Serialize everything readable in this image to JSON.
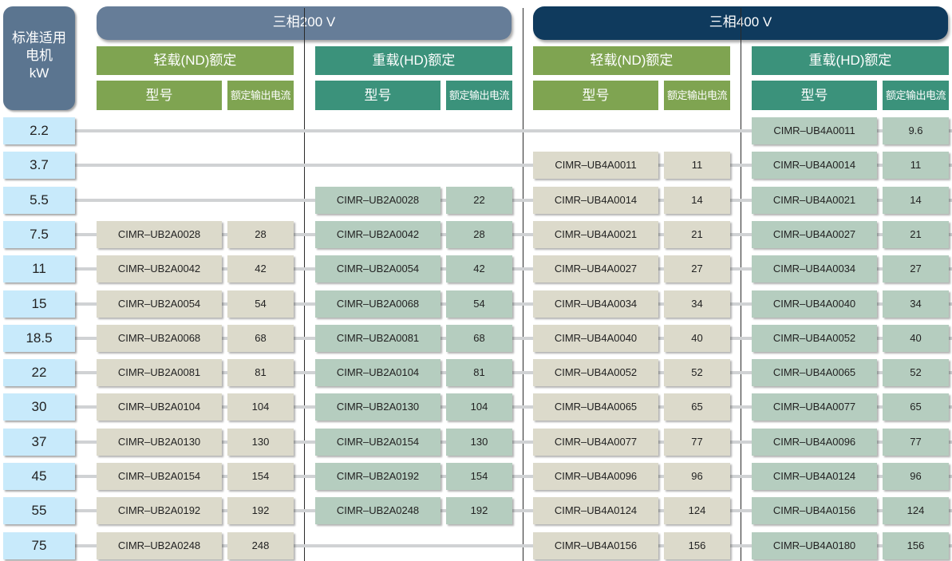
{
  "header": {
    "kw_label_lines": [
      "标准适用",
      "电机",
      "kW"
    ],
    "phase_200": "三相200 V",
    "phase_400": "三相400 V",
    "rating_light": "轻载(ND)额定",
    "rating_heavy": "重载(HD)额定",
    "col_model": "型号",
    "col_current": "额定输出电流"
  },
  "colors": {
    "phase_200": "#667d98",
    "phase_400": "#0f3a5d",
    "light_duty": "#7fa451",
    "heavy_duty": "#3b927b",
    "kw_cell": "#c8eafb",
    "light_cell": "#dcdacb",
    "heavy_cell": "#b5cdbf"
  },
  "rows": [
    {
      "kw": "2.2",
      "a_nd": null,
      "a_hd": null,
      "b_nd": null,
      "b_hd": {
        "model": "CIMR–UB4A0011",
        "current": "9.6"
      }
    },
    {
      "kw": "3.7",
      "a_nd": null,
      "a_hd": null,
      "b_nd": {
        "model": "CIMR–UB4A0011",
        "current": "11"
      },
      "b_hd": {
        "model": "CIMR–UB4A0014",
        "current": "11"
      }
    },
    {
      "kw": "5.5",
      "a_nd": null,
      "a_hd": {
        "model": "CIMR–UB2A0028",
        "current": "22"
      },
      "b_nd": {
        "model": "CIMR–UB4A0014",
        "current": "14"
      },
      "b_hd": {
        "model": "CIMR–UB4A0021",
        "current": "14"
      }
    },
    {
      "kw": "7.5",
      "a_nd": {
        "model": "CIMR–UB2A0028",
        "current": "28"
      },
      "a_hd": {
        "model": "CIMR–UB2A0042",
        "current": "28"
      },
      "b_nd": {
        "model": "CIMR–UB4A0021",
        "current": "21"
      },
      "b_hd": {
        "model": "CIMR–UB4A0027",
        "current": "21"
      }
    },
    {
      "kw": "11",
      "a_nd": {
        "model": "CIMR–UB2A0042",
        "current": "42"
      },
      "a_hd": {
        "model": "CIMR–UB2A0054",
        "current": "42"
      },
      "b_nd": {
        "model": "CIMR–UB4A0027",
        "current": "27"
      },
      "b_hd": {
        "model": "CIMR–UB4A0034",
        "current": "27"
      }
    },
    {
      "kw": "15",
      "a_nd": {
        "model": "CIMR–UB2A0054",
        "current": "54"
      },
      "a_hd": {
        "model": "CIMR–UB2A0068",
        "current": "54"
      },
      "b_nd": {
        "model": "CIMR–UB4A0034",
        "current": "34"
      },
      "b_hd": {
        "model": "CIMR–UB4A0040",
        "current": "34"
      }
    },
    {
      "kw": "18.5",
      "a_nd": {
        "model": "CIMR–UB2A0068",
        "current": "68"
      },
      "a_hd": {
        "model": "CIMR–UB2A0081",
        "current": "68"
      },
      "b_nd": {
        "model": "CIMR–UB4A0040",
        "current": "40"
      },
      "b_hd": {
        "model": "CIMR–UB4A0052",
        "current": "40"
      }
    },
    {
      "kw": "22",
      "a_nd": {
        "model": "CIMR–UB2A0081",
        "current": "81"
      },
      "a_hd": {
        "model": "CIMR–UB2A0104",
        "current": "81"
      },
      "b_nd": {
        "model": "CIMR–UB4A0052",
        "current": "52"
      },
      "b_hd": {
        "model": "CIMR–UB4A0065",
        "current": "52"
      }
    },
    {
      "kw": "30",
      "a_nd": {
        "model": "CIMR–UB2A0104",
        "current": "104"
      },
      "a_hd": {
        "model": "CIMR–UB2A0130",
        "current": "104"
      },
      "b_nd": {
        "model": "CIMR–UB4A0065",
        "current": "65"
      },
      "b_hd": {
        "model": "CIMR–UB4A0077",
        "current": "65"
      }
    },
    {
      "kw": "37",
      "a_nd": {
        "model": "CIMR–UB2A0130",
        "current": "130"
      },
      "a_hd": {
        "model": "CIMR–UB2A0154",
        "current": "130"
      },
      "b_nd": {
        "model": "CIMR–UB4A0077",
        "current": "77"
      },
      "b_hd": {
        "model": "CIMR–UB4A0096",
        "current": "77"
      }
    },
    {
      "kw": "45",
      "a_nd": {
        "model": "CIMR–UB2A0154",
        "current": "154"
      },
      "a_hd": {
        "model": "CIMR–UB2A0192",
        "current": "154"
      },
      "b_nd": {
        "model": "CIMR–UB4A0096",
        "current": "96"
      },
      "b_hd": {
        "model": "CIMR–UB4A0124",
        "current": "96"
      }
    },
    {
      "kw": "55",
      "a_nd": {
        "model": "CIMR–UB2A0192",
        "current": "192"
      },
      "a_hd": {
        "model": "CIMR–UB2A0248",
        "current": "192"
      },
      "b_nd": {
        "model": "CIMR–UB4A0124",
        "current": "124"
      },
      "b_hd": {
        "model": "CIMR–UB4A0156",
        "current": "124"
      }
    },
    {
      "kw": "75",
      "a_nd": {
        "model": "CIMR–UB2A0248",
        "current": "248"
      },
      "a_hd": null,
      "b_nd": {
        "model": "CIMR–UB4A0156",
        "current": "156"
      },
      "b_hd": {
        "model": "CIMR–UB4A0180",
        "current": "156"
      }
    }
  ]
}
